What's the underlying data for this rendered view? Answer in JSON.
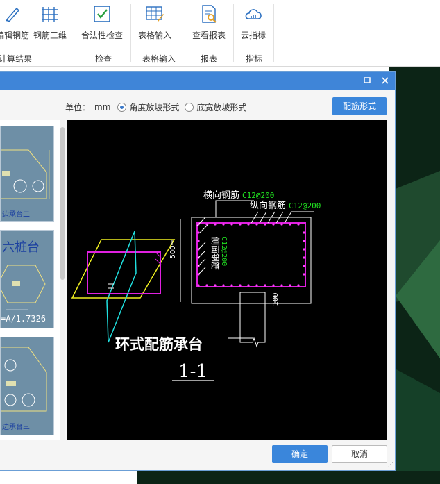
{
  "ribbon": {
    "buttons": [
      {
        "label": "编辑钢筋",
        "icon": "edit-rebar-icon"
      },
      {
        "label": "钢筋三维",
        "icon": "rebar-3d-icon"
      },
      {
        "label": "合法性检查",
        "icon": "validity-check-icon"
      },
      {
        "label": "表格输入",
        "icon": "table-input-icon"
      },
      {
        "label": "查看报表",
        "icon": "view-report-icon"
      },
      {
        "label": "云指标",
        "icon": "cloud-index-icon"
      }
    ],
    "groups": [
      "计算结果",
      "检查",
      "表格输入",
      "报表",
      "指标"
    ]
  },
  "dialog": {
    "unit_label": "单位：",
    "unit_value": "mm",
    "radio_options": [
      {
        "label": "角度放坡形式",
        "selected": true
      },
      {
        "label": "底宽放坡形式",
        "selected": false
      }
    ],
    "rebar_form_button": "配筋形式",
    "ok_button": "确定",
    "cancel_button": "取消",
    "thumbnails": [
      {
        "caption": "边承台二"
      },
      {
        "caption": "六桩台",
        "sub": "=A/1.7326"
      },
      {
        "caption": "边承台三"
      }
    ]
  },
  "drawing": {
    "label_horizontal": "横向钢筋",
    "label_horizontal_spec": "C12@200",
    "label_longitudinal": "纵向钢筋",
    "label_longitudinal_spec": "C12@200",
    "label_side": "侧面钢筋",
    "label_side_spec": "C12@200",
    "dim_500": "500",
    "dim_100": "100",
    "title": "环式配筋承台",
    "section": "1-1"
  },
  "colors": {
    "titlebar": "#3f85d8",
    "accent_button": "#3a86db",
    "rebar_magenta": "#e020e0",
    "cad_green": "#20e020",
    "cad_yellow": "#f0f020",
    "cad_cyan": "#20e0e0"
  }
}
